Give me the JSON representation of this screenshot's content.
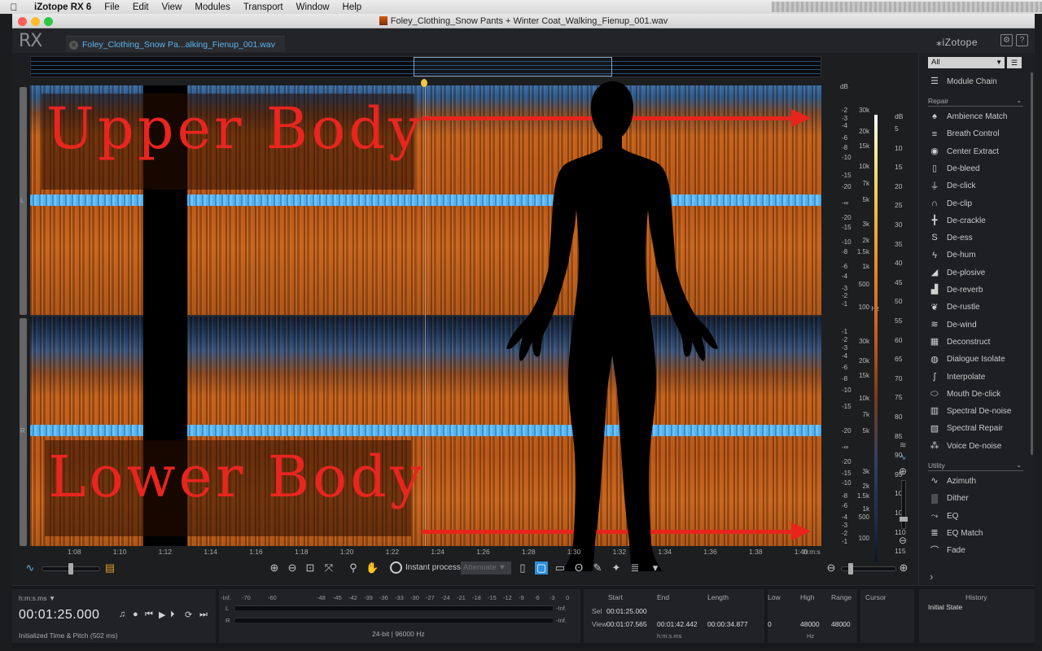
{
  "menubar": {
    "app_name": "iZotope RX 6",
    "items": [
      "File",
      "Edit",
      "View",
      "Modules",
      "Transport",
      "Window",
      "Help"
    ]
  },
  "window": {
    "title": "Foley_Clothing_Snow Pants + Winter Coat_Walking_Fienup_001.wav"
  },
  "app": {
    "logo": "RX",
    "file_tab": "Foley_Clothing_Snow Pa...alking_Fienup_001.wav",
    "brand": "iZotope"
  },
  "spectrogram": {
    "channels": [
      "L",
      "R"
    ],
    "overlay_upper": "Upper Body",
    "overlay_lower": "Lower Body",
    "db_unit": "dB",
    "db_ticks_top": [
      "-2",
      "-3",
      "-4",
      "-6",
      "-8",
      "-10",
      "-15",
      "-20",
      "-∞",
      "-20",
      "-15",
      "-10",
      "-8",
      "-6",
      "-4",
      "-3",
      "-2",
      "-1"
    ],
    "db_ticks_bottom": [
      "-1",
      "-2",
      "-3",
      "-4",
      "-6",
      "-8",
      "-10",
      "-15",
      "-20",
      "-∞",
      "-20",
      "-15",
      "-10",
      "-8",
      "-6",
      "-4",
      "-3",
      "-2",
      "-1"
    ],
    "hz_unit": "Hz",
    "hz_ticks": [
      "30k",
      "20k",
      "15k",
      "10k",
      "7k",
      "5k",
      "3k",
      "2k",
      "1.5k",
      "1k",
      "500",
      "100"
    ],
    "color_unit": "dB",
    "color_ticks": [
      "5",
      "10",
      "15",
      "20",
      "25",
      "30",
      "35",
      "40",
      "45",
      "50",
      "55",
      "60",
      "65",
      "70",
      "75",
      "80",
      "85",
      "90",
      "95",
      "100",
      "105",
      "110",
      "115"
    ],
    "time_ticks": [
      "1:08",
      "1:10",
      "1:12",
      "1:14",
      "1:16",
      "1:18",
      "1:20",
      "1:22",
      "1:24",
      "1:26",
      "1:28",
      "1:30",
      "1:32",
      "1:34",
      "1:36",
      "1:38",
      "1:40"
    ],
    "time_unit": "h:m:s"
  },
  "toolbar": {
    "instant_process_label": "Instant process",
    "attenuate_value": "Attenuate"
  },
  "sidebar": {
    "filter_value": "All",
    "module_chain": "Module Chain",
    "repair_label": "Repair",
    "repair_items": [
      {
        "label": "Ambience Match",
        "icon": "ambience-match-icon",
        "glyph": "♠"
      },
      {
        "label": "Breath Control",
        "icon": "breath-control-icon",
        "glyph": "≡"
      },
      {
        "label": "Center Extract",
        "icon": "center-extract-icon",
        "glyph": "◉"
      },
      {
        "label": "De-bleed",
        "icon": "de-bleed-icon",
        "glyph": "▯"
      },
      {
        "label": "De-click",
        "icon": "de-click-icon",
        "glyph": "⏚"
      },
      {
        "label": "De-clip",
        "icon": "de-clip-icon",
        "glyph": "∩"
      },
      {
        "label": "De-crackle",
        "icon": "de-crackle-icon",
        "glyph": "╋"
      },
      {
        "label": "De-ess",
        "icon": "de-ess-icon",
        "glyph": "S"
      },
      {
        "label": "De-hum",
        "icon": "de-hum-icon",
        "glyph": "ϟ"
      },
      {
        "label": "De-plosive",
        "icon": "de-plosive-icon",
        "glyph": "◢"
      },
      {
        "label": "De-reverb",
        "icon": "de-reverb-icon",
        "glyph": "▟"
      },
      {
        "label": "De-rustle",
        "icon": "de-rustle-icon",
        "glyph": "❦"
      },
      {
        "label": "De-wind",
        "icon": "de-wind-icon",
        "glyph": "≋"
      },
      {
        "label": "Deconstruct",
        "icon": "deconstruct-icon",
        "glyph": "▦"
      },
      {
        "label": "Dialogue Isolate",
        "icon": "dialogue-isolate-icon",
        "glyph": "◍"
      },
      {
        "label": "Interpolate",
        "icon": "interpolate-icon",
        "glyph": "∫"
      },
      {
        "label": "Mouth De-click",
        "icon": "mouth-de-click-icon",
        "glyph": "⬭"
      },
      {
        "label": "Spectral De-noise",
        "icon": "spectral-de-noise-icon",
        "glyph": "▥"
      },
      {
        "label": "Spectral Repair",
        "icon": "spectral-repair-icon",
        "glyph": "▧"
      },
      {
        "label": "Voice De-noise",
        "icon": "voice-de-noise-icon",
        "glyph": "⁂"
      }
    ],
    "utility_label": "Utility",
    "utility_items": [
      {
        "label": "Azimuth",
        "icon": "azimuth-icon",
        "glyph": "∿"
      },
      {
        "label": "Dither",
        "icon": "dither-icon",
        "glyph": "▒"
      },
      {
        "label": "EQ",
        "icon": "eq-icon",
        "glyph": "⤳"
      },
      {
        "label": "EQ Match",
        "icon": "eq-match-icon",
        "glyph": "≣"
      },
      {
        "label": "Fade",
        "icon": "fade-icon",
        "glyph": "⌒"
      }
    ]
  },
  "bottom": {
    "time_format": "h:m:s.ms ▼",
    "current_time": "00:01:25.000",
    "status": "Initialized Time & Pitch (502 ms)",
    "meter_ticks": [
      "-Inf.",
      "-70",
      "-60",
      "-48",
      "-45",
      "-42",
      "-39",
      "-36",
      "-33",
      "-30",
      "-27",
      "-24",
      "-21",
      "-18",
      "-15",
      "-12",
      "-9",
      "-6",
      "-3",
      "0"
    ],
    "meter_l": "L",
    "meter_r": "R",
    "meter_l_inf": "-Inf.",
    "meter_r_inf": "-Inf.",
    "format": "24-bit | 96000 Hz",
    "sel_headers": {
      "start": "Start",
      "end": "End",
      "length": "Length"
    },
    "sel_label": "Sel",
    "view_label": "View",
    "sel_start": "00:01:25.000",
    "view_start": "00:01:07.565",
    "view_end": "00:01:42.442",
    "view_length": "00:00:34.877",
    "sel_unit": "h:m:s.ms",
    "freq_headers": {
      "low": "Low",
      "high": "High",
      "range": "Range"
    },
    "freq_low": "0",
    "freq_high": "48000",
    "freq_range": "48000",
    "freq_unit": "Hz",
    "cursor_label": "Cursor",
    "history_title": "History",
    "history_item": "Initial State"
  },
  "colors": {
    "accent_blue": "#5bb4f0",
    "overlay_red": "#e8251f",
    "playhead_marker": "#f2c744"
  }
}
